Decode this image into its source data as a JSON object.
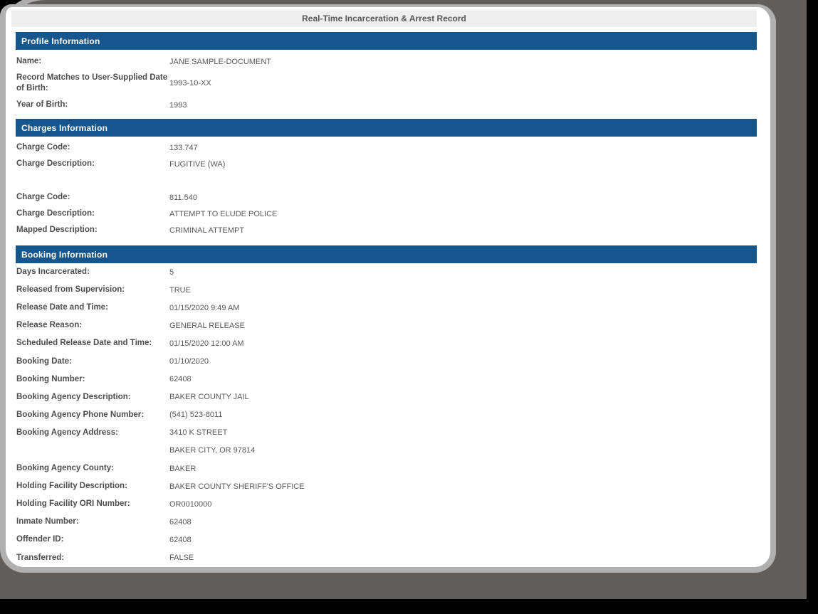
{
  "frame": {
    "accent_blue": "#17568c",
    "silver_border": "#b0b0b0",
    "dark_background": "#615d5b",
    "outer_background": "#000000",
    "titlebar_background": "#efeff0"
  },
  "report": {
    "title": "Real-Time Incarceration & Arrest Record",
    "sections": [
      {
        "title": "Profile Information",
        "rows": [
          {
            "label": "Name:",
            "value": "JANE SAMPLE-DOCUMENT"
          },
          {
            "label": "Record Matches to User-Supplied Date of Birth:",
            "value": "1993-10-XX"
          },
          {
            "label": "Year of Birth:",
            "value": "1993"
          }
        ]
      },
      {
        "title": "Charges Information",
        "groups": [
          {
            "rows": [
              {
                "label": "Charge Code:",
                "value": "133.747"
              },
              {
                "label": "Charge Description:",
                "value": "FUGITIVE (WA)"
              }
            ]
          },
          {
            "rows": [
              {
                "label": "Charge Code:",
                "value": "811.540"
              },
              {
                "label": "Charge Description:",
                "value": "ATTEMPT TO ELUDE POLICE"
              },
              {
                "label": "Mapped Description:",
                "value": "CRIMINAL ATTEMPT"
              }
            ]
          }
        ]
      },
      {
        "title": "Booking Information",
        "rows": [
          {
            "label": "Days Incarcerated:",
            "value": "5"
          },
          {
            "label": "Released from Supervision:",
            "value": "TRUE"
          },
          {
            "label": "Release Date and Time:",
            "value": "01/15/2020 9:49 AM"
          },
          {
            "label": "Release Reason:",
            "value": "GENERAL RELEASE"
          },
          {
            "label": "Scheduled Release Date and Time:",
            "value": "01/15/2020 12:00 AM"
          },
          {
            "label": "Booking Date:",
            "value": "01/10/2020"
          },
          {
            "label": "Booking Number:",
            "value": "62408"
          },
          {
            "label": "Booking Agency Description:",
            "value": "BAKER COUNTY JAIL"
          },
          {
            "label": "Booking Agency Phone Number:",
            "value": "(541) 523-8011"
          },
          {
            "label": "Booking Agency Address:",
            "value": "3410 K STREET"
          },
          {
            "label": "",
            "value": "BAKER CITY, OR 97814"
          },
          {
            "label": "Booking Agency County:",
            "value": "BAKER"
          },
          {
            "label": "Holding Facility Description:",
            "value": "BAKER COUNTY SHERIFF'S OFFICE"
          },
          {
            "label": "Holding Facility ORI Number:",
            "value": "OR0010000"
          },
          {
            "label": "Inmate Number:",
            "value": "62408"
          },
          {
            "label": "Offender ID:",
            "value": "62408"
          },
          {
            "label": "Transferred:",
            "value": "FALSE"
          }
        ]
      }
    ]
  }
}
